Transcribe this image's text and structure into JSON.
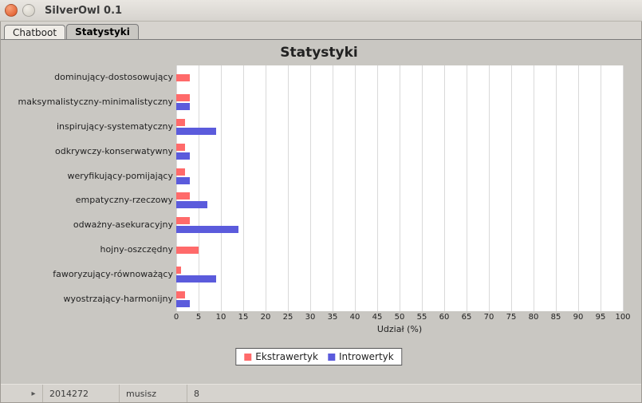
{
  "window": {
    "title": "SilverOwl 0.1"
  },
  "tabs": {
    "chatboot": "Chatboot",
    "statystyki": "Statystyki"
  },
  "chart_data": {
    "type": "bar",
    "title": "Statystyki",
    "xlabel": "Udział (%)",
    "ylabel": "",
    "xlim": [
      0,
      100
    ],
    "xticks": [
      0,
      5,
      10,
      15,
      20,
      25,
      30,
      35,
      40,
      45,
      50,
      55,
      60,
      65,
      70,
      75,
      80,
      85,
      90,
      95,
      100
    ],
    "categories": [
      "dominujący-dostosowujący",
      "maksymalistyczny-minimalistyczny",
      "inspirujący-systematyczny",
      "odkrywczy-konserwatywny",
      "weryfikujący-pomijający",
      "empatyczny-rzeczowy",
      "odważny-asekuracyjny",
      "hojny-oszczędny",
      "faworyzujący-równoważący",
      "wyostrzający-harmonijny"
    ],
    "series": [
      {
        "name": "Ekstrawertyk",
        "color": "#ff6a6a",
        "values": [
          3,
          3,
          2,
          2,
          2,
          3,
          3,
          5,
          1,
          2
        ]
      },
      {
        "name": "Introwertyk",
        "color": "#5b5bdc",
        "values": [
          0,
          3,
          9,
          3,
          3,
          7,
          14,
          0,
          9,
          3
        ]
      }
    ],
    "legend": {
      "position": "bottom"
    }
  },
  "legend": {
    "ekstrawertyk": "Ekstrawertyk",
    "introwertyk": "Introwertyk"
  },
  "bottom_row": {
    "col1": "2014272",
    "col2": "musisz",
    "col3": "8"
  }
}
